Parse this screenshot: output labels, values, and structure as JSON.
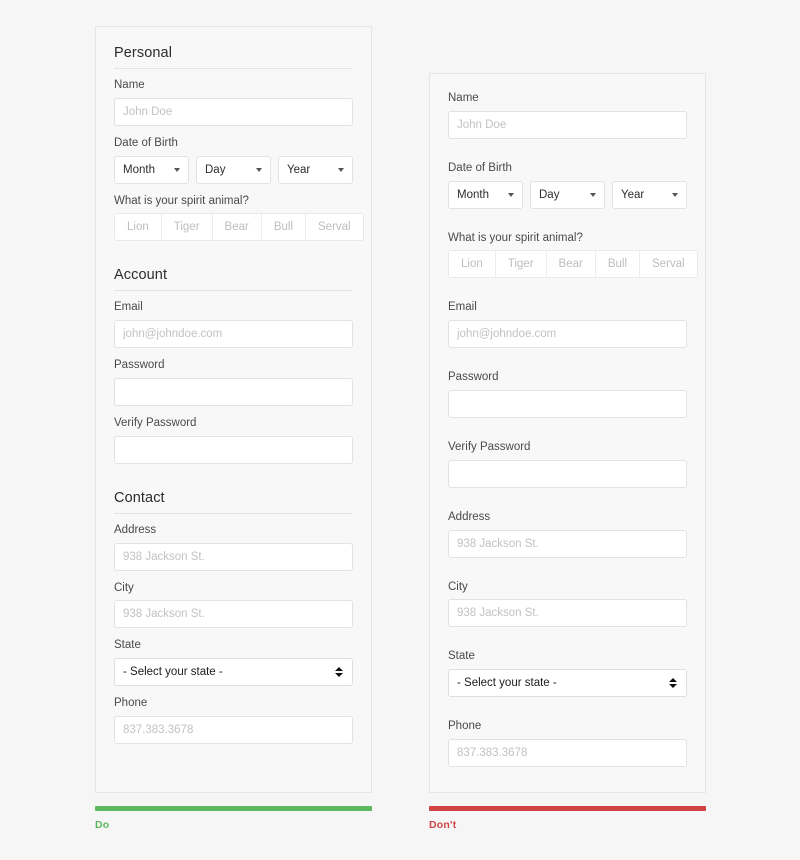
{
  "colors": {
    "do_accent": "#5cb85c",
    "dont_accent": "#cf4444",
    "page_background": "#f6f6f6",
    "panel_background": "#f8f8f8",
    "panel_border": "#e6e6e6",
    "input_border": "#e2e2e2",
    "placeholder_text": "#c2c2c2",
    "label_text": "#4a4a4a",
    "segmented_text": "#bdbdbd"
  },
  "do_panel": {
    "sections": [
      {
        "title": "Personal",
        "fields": [
          {
            "type": "text",
            "label": "Name",
            "placeholder": "John Doe",
            "value": ""
          },
          {
            "type": "date-group",
            "label": "Date of Birth",
            "selects": [
              {
                "label": "Month"
              },
              {
                "label": "Day"
              },
              {
                "label": "Year"
              }
            ]
          },
          {
            "type": "button-group",
            "label": "What is your spirit animal?",
            "options": [
              "Lion",
              "Tiger",
              "Bear",
              "Bull",
              "Serval"
            ]
          }
        ]
      },
      {
        "title": "Account",
        "fields": [
          {
            "type": "text",
            "label": "Email",
            "placeholder": "john@johndoe.com",
            "value": ""
          },
          {
            "type": "text",
            "label": "Password",
            "placeholder": "",
            "value": ""
          },
          {
            "type": "text",
            "label": "Verify Password",
            "placeholder": "",
            "value": ""
          }
        ]
      },
      {
        "title": "Contact",
        "fields": [
          {
            "type": "text",
            "label": "Address",
            "placeholder": "938 Jackson St.",
            "value": ""
          },
          {
            "type": "text",
            "label": "City",
            "placeholder": "938 Jackson St.",
            "value": ""
          },
          {
            "type": "select",
            "label": "State",
            "selected": "- Select your state -"
          },
          {
            "type": "text",
            "label": "Phone",
            "placeholder": "837.383.3678",
            "value": ""
          }
        ]
      }
    ]
  },
  "dont_panel": {
    "fields": [
      {
        "type": "text",
        "label": "Name",
        "placeholder": "John Doe",
        "value": ""
      },
      {
        "type": "date-group",
        "label": "Date of Birth",
        "selects": [
          {
            "label": "Month"
          },
          {
            "label": "Day"
          },
          {
            "label": "Year"
          }
        ]
      },
      {
        "type": "button-group",
        "label": "What is your spirit animal?",
        "options": [
          "Lion",
          "Tiger",
          "Bear",
          "Bull",
          "Serval"
        ]
      },
      {
        "type": "text",
        "label": "Email",
        "placeholder": "john@johndoe.com",
        "value": ""
      },
      {
        "type": "text",
        "label": "Password",
        "placeholder": "",
        "value": ""
      },
      {
        "type": "text",
        "label": "Verify Password",
        "placeholder": "",
        "value": ""
      },
      {
        "type": "text",
        "label": "Address",
        "placeholder": "938 Jackson St.",
        "value": ""
      },
      {
        "type": "text",
        "label": "City",
        "placeholder": "938 Jackson St.",
        "value": ""
      },
      {
        "type": "select",
        "label": "State",
        "selected": "- Select your state -"
      },
      {
        "type": "text",
        "label": "Phone",
        "placeholder": "837.383.3678",
        "value": ""
      }
    ]
  },
  "verdicts": {
    "do": {
      "label": "Do",
      "color": "#5cb85c"
    },
    "dont": {
      "label": "Don't",
      "color": "#cf4444"
    }
  }
}
